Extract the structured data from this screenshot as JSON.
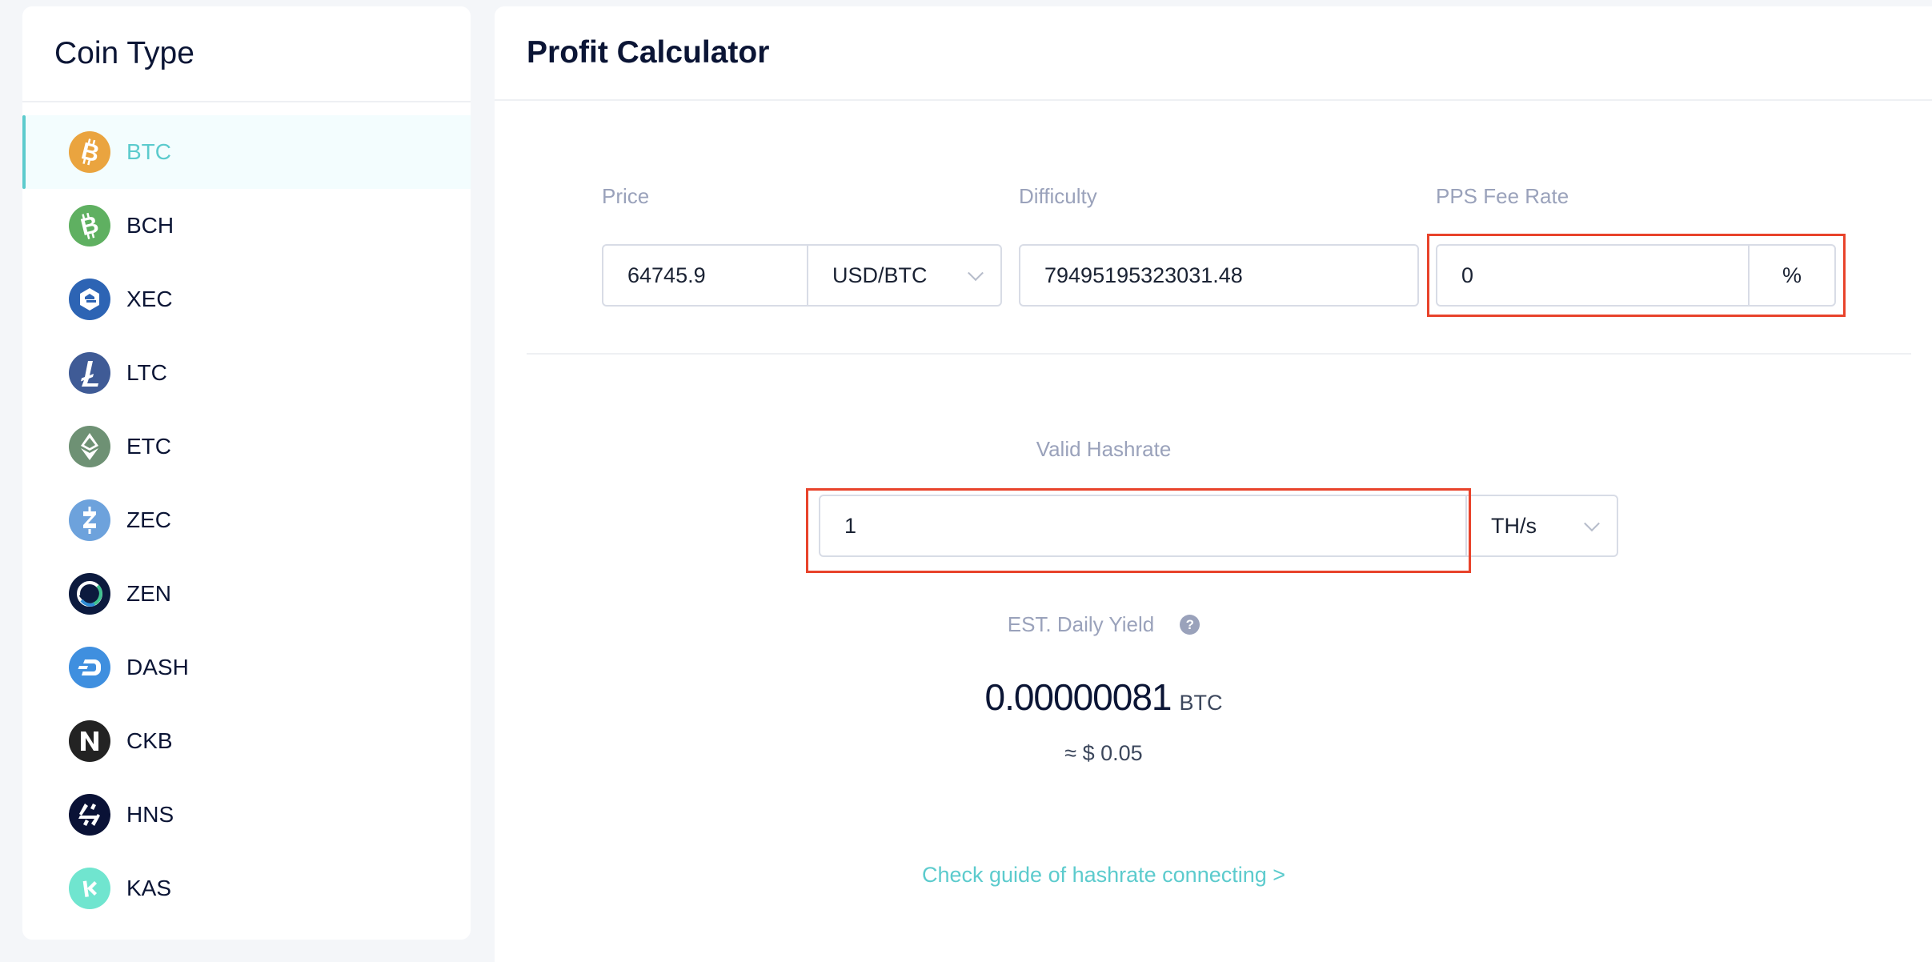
{
  "sidebar": {
    "title": "Coin Type",
    "items": [
      {
        "label": "BTC",
        "icon": "bitcoin-icon",
        "color": "#eaa43f",
        "active": true
      },
      {
        "label": "BCH",
        "icon": "bitcoin-cash-icon",
        "color": "#5fb061",
        "active": false
      },
      {
        "label": "XEC",
        "icon": "ecash-icon",
        "color": "#2d64b4",
        "active": false
      },
      {
        "label": "LTC",
        "icon": "litecoin-icon",
        "color": "#3f5b96",
        "active": false
      },
      {
        "label": "ETC",
        "icon": "ethereum-classic-icon",
        "color": "#6e9174",
        "active": false
      },
      {
        "label": "ZEC",
        "icon": "zcash-icon",
        "color": "#6da2dc",
        "active": false
      },
      {
        "label": "ZEN",
        "icon": "horizen-icon",
        "color": "#0c1a3e",
        "active": false
      },
      {
        "label": "DASH",
        "icon": "dash-icon",
        "color": "#3f8fdf",
        "active": false
      },
      {
        "label": "CKB",
        "icon": "nervos-icon",
        "color": "#232323",
        "active": false
      },
      {
        "label": "HNS",
        "icon": "handshake-icon",
        "color": "#0a1236",
        "active": false
      },
      {
        "label": "KAS",
        "icon": "kaspa-icon",
        "color": "#70e5cf",
        "active": false
      }
    ]
  },
  "main": {
    "title": "Profit Calculator",
    "price": {
      "label": "Price",
      "value": "64745.9",
      "unit": "USD/BTC"
    },
    "difficulty": {
      "label": "Difficulty",
      "value": "79495195323031.48"
    },
    "pps_fee": {
      "label": "PPS Fee Rate",
      "value": "0",
      "suffix": "%"
    },
    "hashrate": {
      "label": "Valid Hashrate",
      "value": "1",
      "unit": "TH/s"
    },
    "yield": {
      "label": "EST. Daily Yield",
      "help_icon": "?",
      "value": "0.00000081",
      "unit": "BTC",
      "usd": "≈ $ 0.05"
    },
    "guide_link": "Check guide of hashrate connecting >"
  },
  "colors": {
    "accent": "#5ccbcd",
    "highlight": "#e8432b",
    "text_dark": "#0b1535",
    "label_gray": "#9aa2bb"
  }
}
